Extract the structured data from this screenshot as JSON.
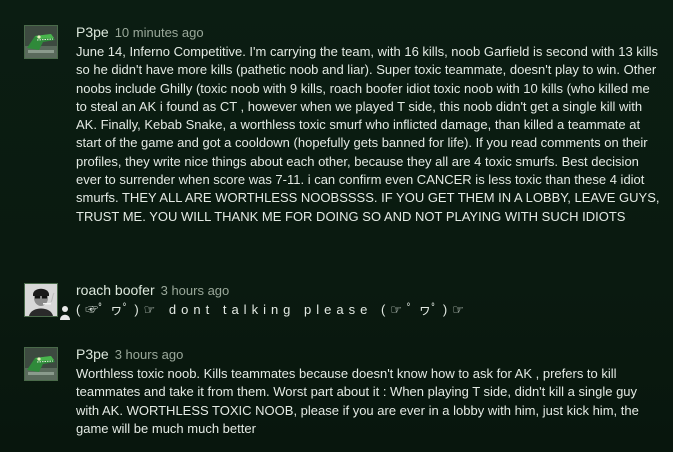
{
  "comments": [
    {
      "author": "P3pe",
      "time": "10 minutes ago",
      "avatar_icon": "crocodile-avatar-icon",
      "text": "June 14, Inferno Competitive. I'm carrying the team, with 16 kills, noob Garfield is second with 13 kills so he didn't have more kills (pathetic noob and liar). Super toxic teammate, doesn't play to win. Other noobs include Ghilly (toxic noob with 9 kills, roach boofer idiot toxic noob with 10 kills (who killed me to steal an AK i found as CT , however when we played T side, this noob didn't get a single kill with AK. Finally, Kebab Snake, a worthless toxic smurf who inflicted damage, than killed a teammate at start of the game and got a cooldown (hopefully gets banned for life). If you read comments on their profiles, they write nice things about each other, because they all are 4 toxic smurfs. Best decision ever to surrender when score was 7-11. i can confirm even CANCER is less toxic than these 4 idiot smurfs. THEY ALL ARE WORTHLESS NOOBSSSS. IF YOU GET THEM IN A LOBBY, LEAVE GUYS, TRUST ME. YOU WILL THANK ME FOR DOING SO AND NOT PLAYING WITH SUCH IDIOTS"
    },
    {
      "author": "roach boofer",
      "time": "3 hours ago",
      "avatar_icon": "smoking-man-avatar-icon",
      "status_icon": "person-status-icon",
      "text": "(☞ﾟヮﾟ)☞ dont  talking  please (☞ﾟヮﾟ)☞"
    },
    {
      "author": "P3pe",
      "time": "3 hours ago",
      "avatar_icon": "crocodile-avatar-icon",
      "text": "Worthless toxic noob. Kills teammates because doesn't know how to ask for AK , prefers to kill teammates and take it from them. Worst part about it : When playing T side, didn't kill a single guy with AK. WORTHLESS TOXIC NOOB, please if you are ever in a lobby with him, just kick him, the game will be much much better"
    }
  ]
}
